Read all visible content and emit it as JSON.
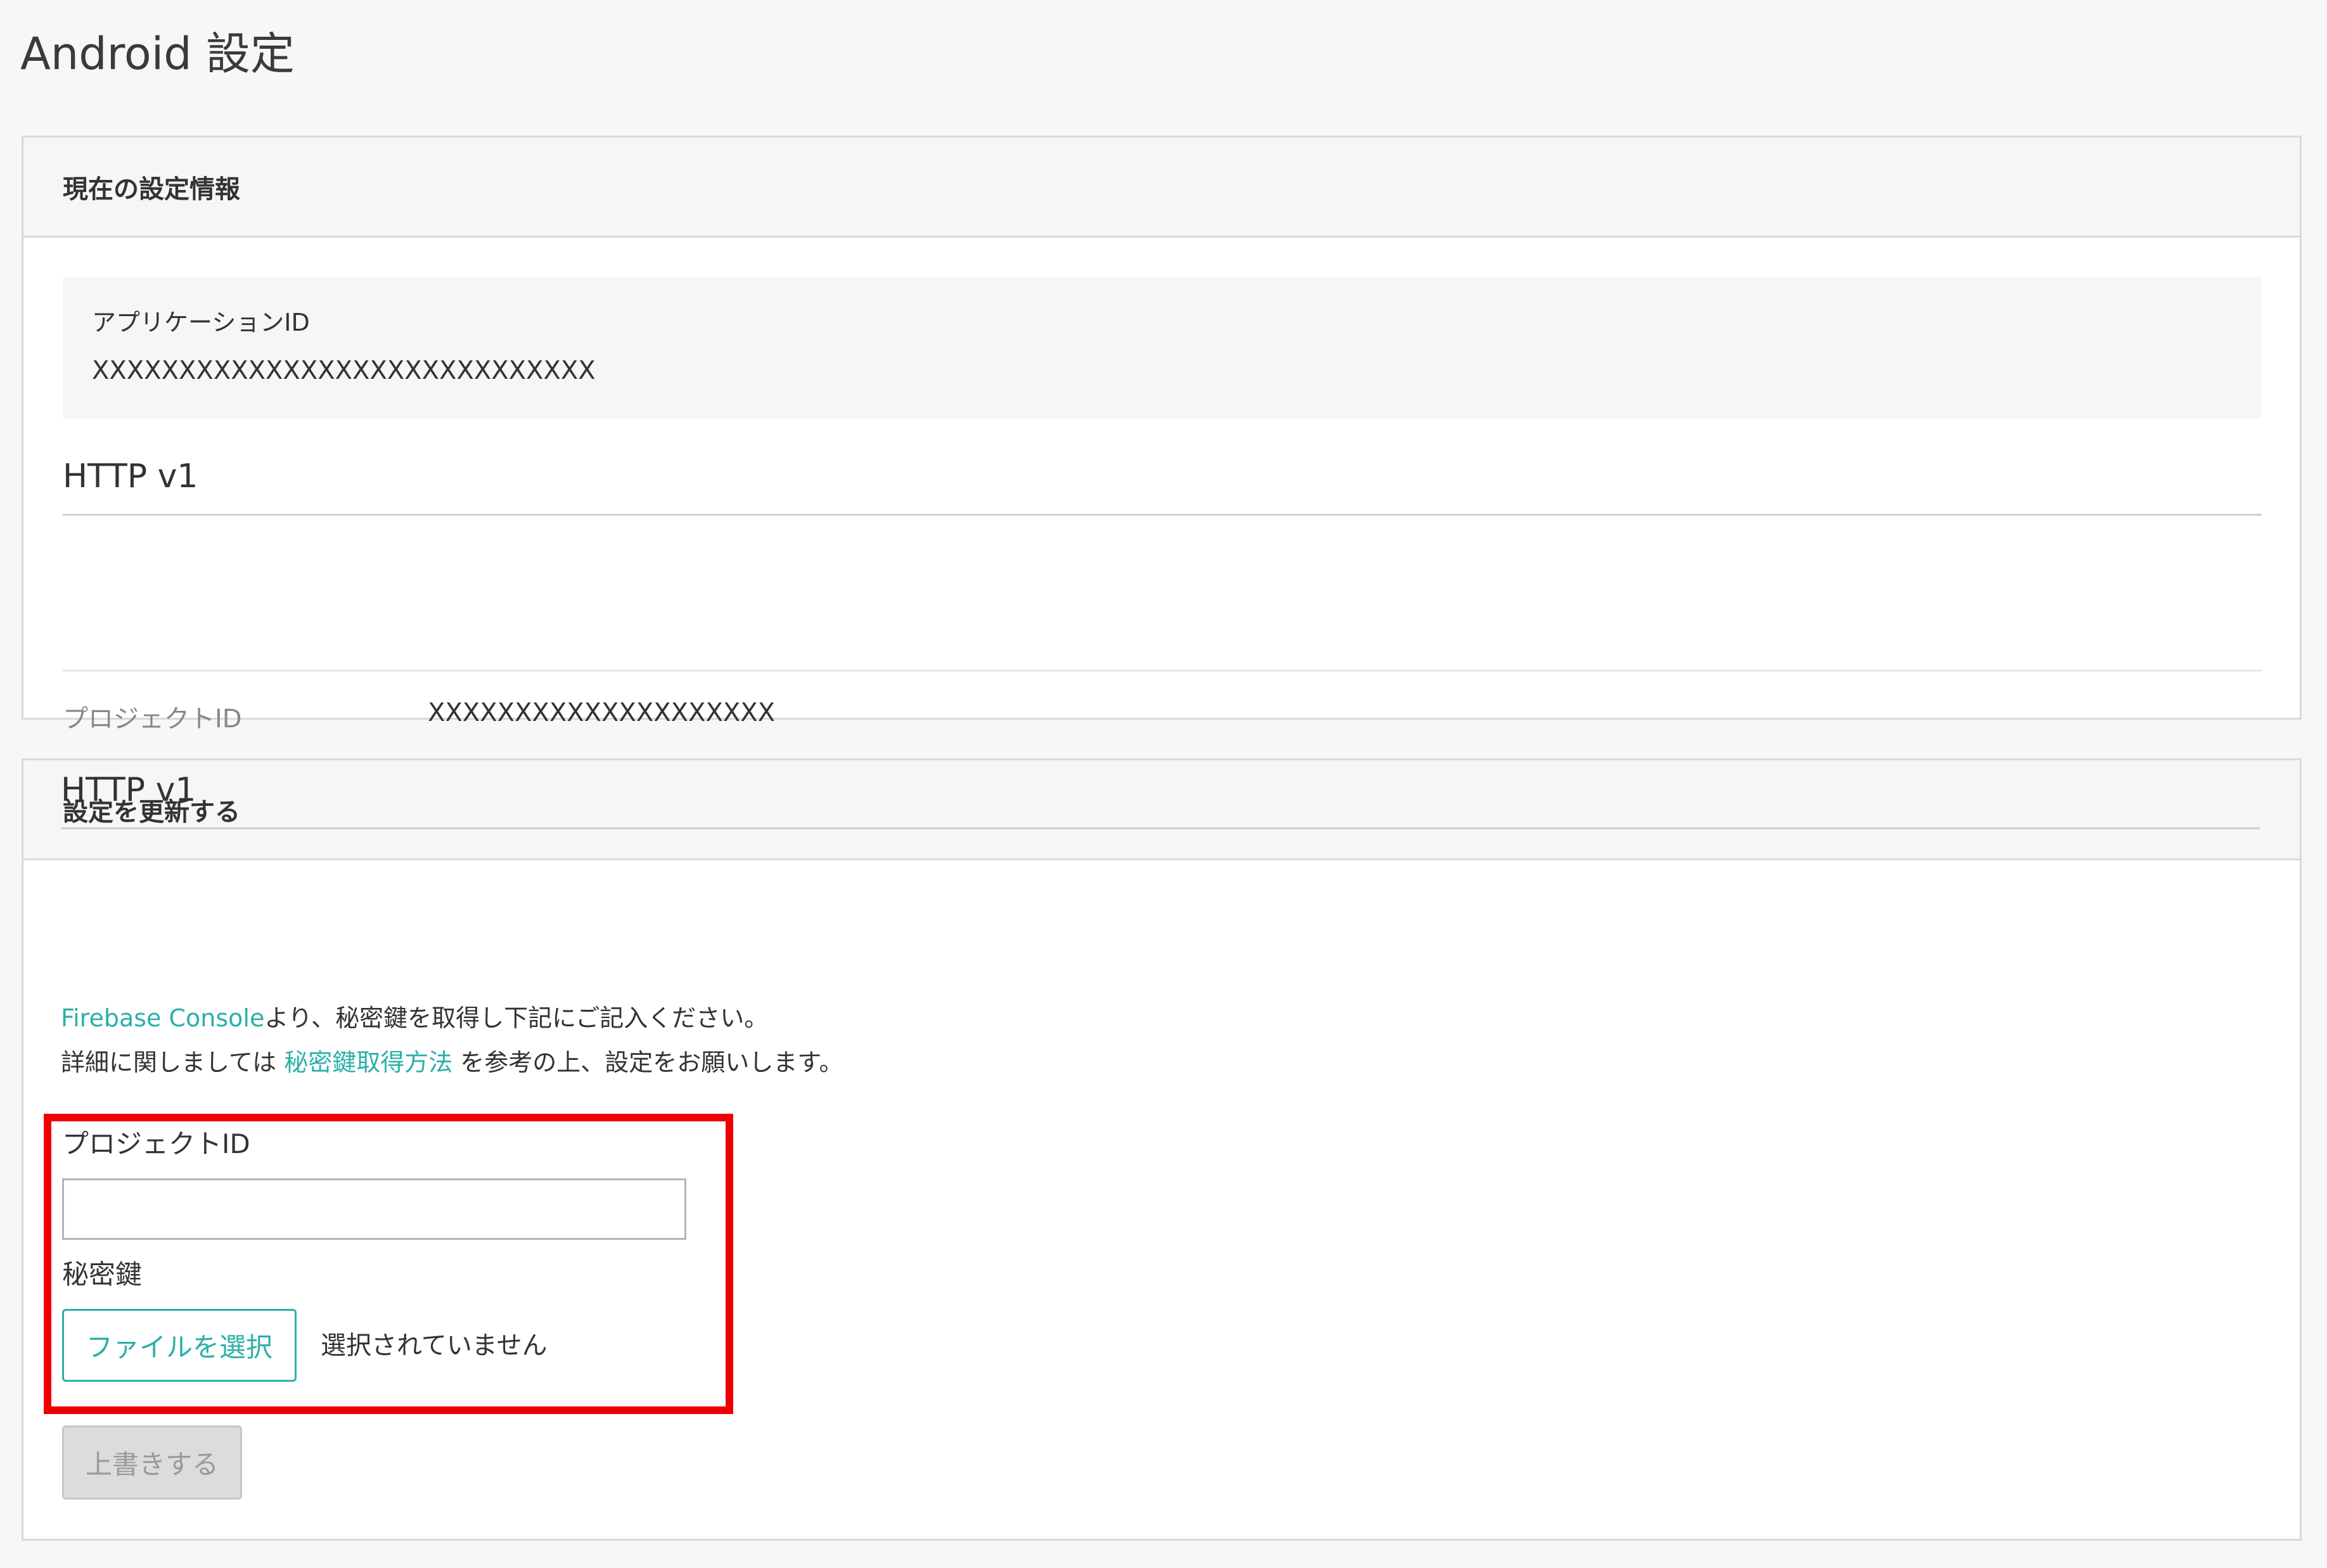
{
  "page": {
    "title": "Android 設定"
  },
  "current_settings": {
    "header": "現在の設定情報",
    "app_id_label": "アプリケーションID",
    "app_id_value": "XXXXXXXXXXXXXXXXXXXXXXXXXXXXX",
    "section_title": "HTTP v1",
    "project_id_label": "プロジェクトID",
    "project_id_value": "XXXXXXXXXXXXXXXXXXXX"
  },
  "update_settings": {
    "header": "設定を更新する",
    "section_title": "HTTP v1",
    "description_line1_link": "Firebase Console",
    "description_line1_text": "より、秘密鍵を取得し下記にご記入ください。",
    "description_line2_prefix": "詳細に関しましては ",
    "description_line2_link": "秘密鍵取得方法",
    "description_line2_suffix": " を参考の上、設定をお願いします。",
    "project_id_label": "プロジェクトID",
    "project_id_input_value": "",
    "private_key_label": "秘密鍵",
    "file_button_label": "ファイルを選択",
    "file_status": "選択されていません",
    "submit_label": "上書きする"
  },
  "colors": {
    "accent": "#2ab0a8",
    "highlight": "#ee0000",
    "panel_header_bg": "#f5f6f7",
    "disabled_button_bg": "#dcdcdc"
  }
}
